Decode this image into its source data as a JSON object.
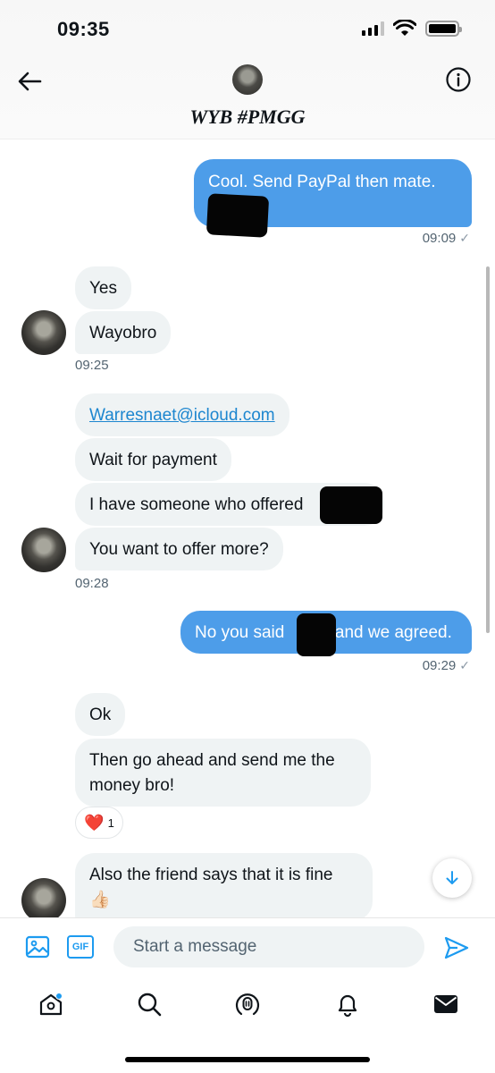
{
  "status_bar": {
    "time": "09:35",
    "battery_level": 1.0,
    "signal_bars_filled": 3,
    "signal_bars_total": 4
  },
  "header": {
    "title": "WYB #PMGG",
    "back_icon": "arrow-left-icon",
    "info_icon": "info-icon"
  },
  "messages": {
    "m1": {
      "text": "Cool. Send PayPal then mate.",
      "time": "09:09",
      "check": "✓"
    },
    "m2": {
      "text": "Yes"
    },
    "m3": {
      "text": "Wayobro",
      "time": "09:25"
    },
    "m4": {
      "text": "Warresnaet@icloud.com"
    },
    "m5": {
      "text": "Wait for payment"
    },
    "m6": {
      "text": "I have someone who offered"
    },
    "m7": {
      "text": "You want to offer more?",
      "time": "09:28"
    },
    "m8": {
      "text_a": "No you said",
      "text_b": "and we agreed.",
      "time": "09:29",
      "check": "✓"
    },
    "m9": {
      "text": "Ok"
    },
    "m10": {
      "line1": "Then go ahead and send me the",
      "line2": "money bro!",
      "reaction_emoji": "❤️",
      "reaction_count": "1"
    },
    "m11": {
      "text": "Also the friend says that it is fine",
      "emoji": "👍🏻"
    }
  },
  "composer": {
    "placeholder": "Start a message",
    "gif_label": "GIF"
  },
  "tabs": [
    "home-icon",
    "search-icon",
    "spaces-icon",
    "notifications-icon",
    "messages-icon"
  ],
  "colors": {
    "outgoing": "#4d9de9",
    "incoming": "#eff3f4",
    "accent": "#1d9bf0"
  }
}
